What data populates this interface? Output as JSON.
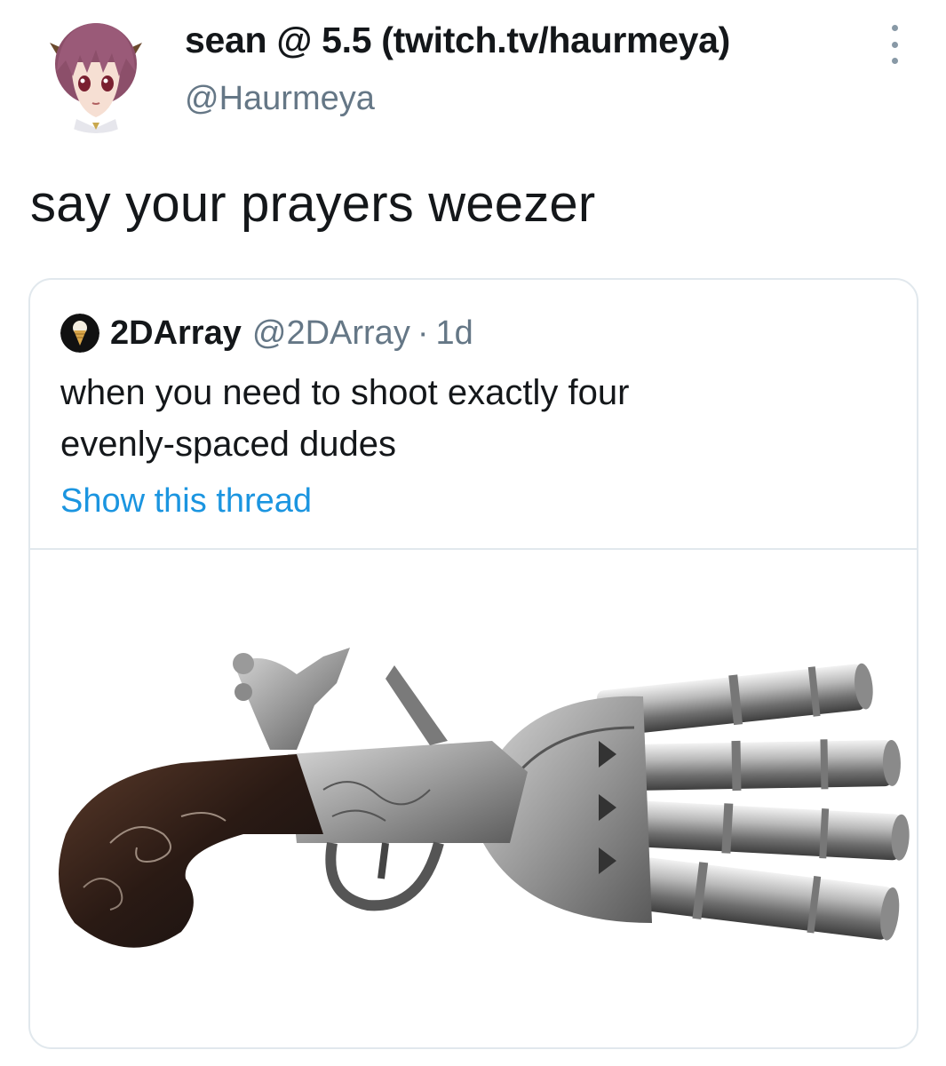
{
  "tweet": {
    "display_name": "sean @ 5.5 (twitch.tv/haurmeya)",
    "handle": "@Haurmeya",
    "text": "say your prayers weezer",
    "avatar_icon": "anime-avatar-icon",
    "menu_icon": "more-options-icon"
  },
  "quoted": {
    "name": "2DArray",
    "handle": "@2DArray",
    "separator": "·",
    "time": "1d",
    "text_lines": [
      "when you need to shoot exactly four",
      "evenly-spaced dudes"
    ],
    "show_thread": "Show this thread",
    "avatar_icon": "ice-cream-cone-icon",
    "media": "four-barrel flintlock duck-foot pistol"
  },
  "colors": {
    "link": "#1b95e0",
    "secondary_text": "#657786",
    "border": "#e1e8ed"
  }
}
